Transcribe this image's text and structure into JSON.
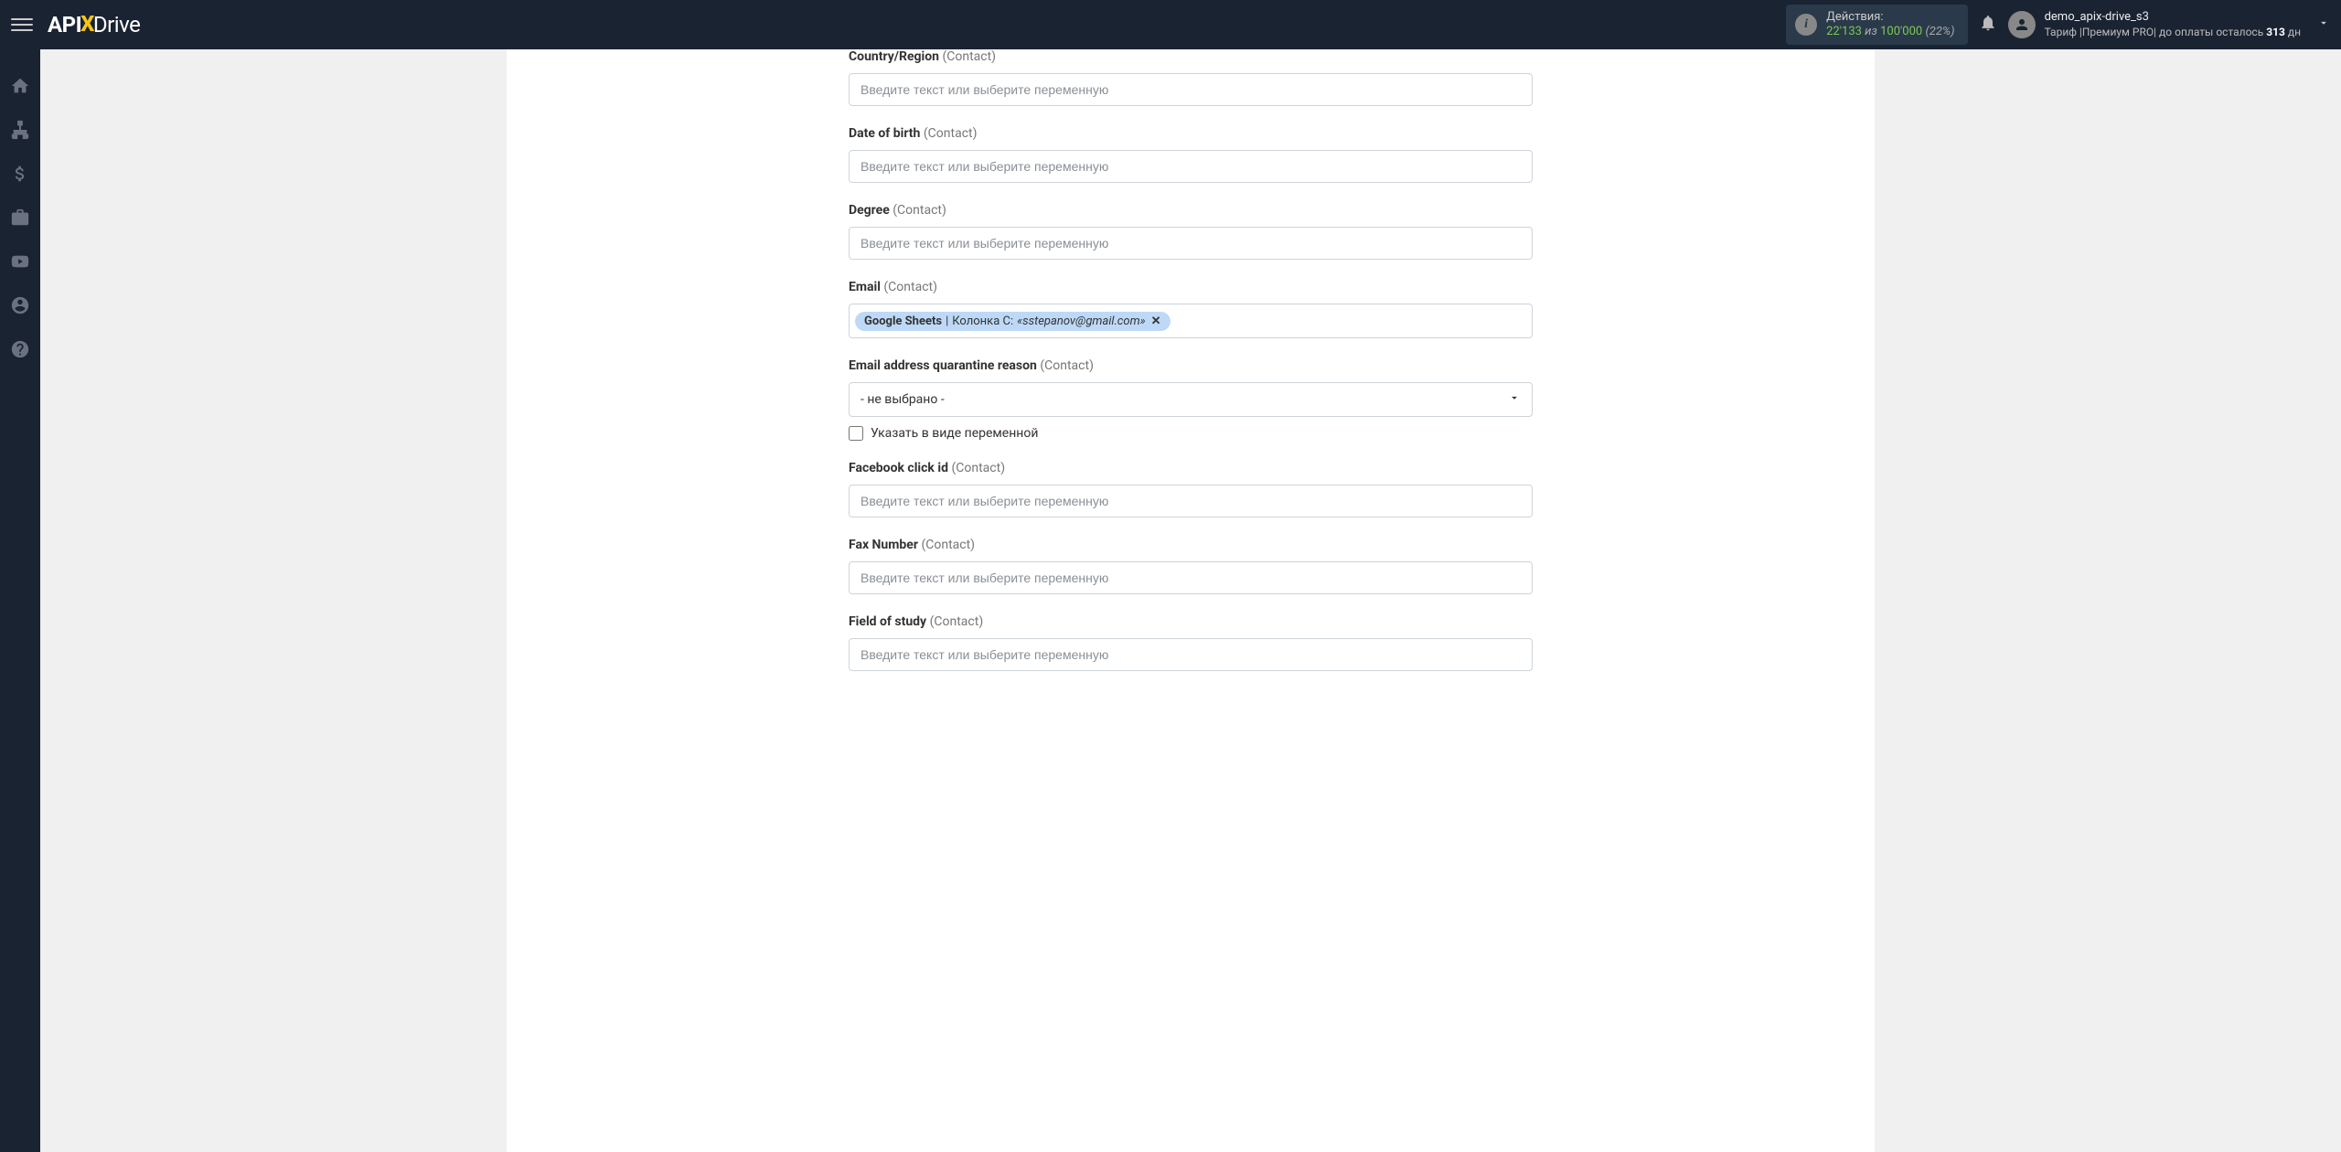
{
  "header": {
    "logo_api": "API",
    "logo_x": "X",
    "logo_drive": "Drive",
    "actions_label": "Действия:",
    "actions_count": "22'133",
    "actions_of": "из",
    "actions_total": "100'000",
    "actions_pct": "(22%)",
    "user_name": "demo_apix-drive_s3",
    "plan_prefix": "Тариф |",
    "plan_name": "Премиум PRO",
    "plan_mid": "| до оплаты осталось ",
    "plan_days": "313",
    "plan_suffix": " дн"
  },
  "form": {
    "placeholder": "Введите текст или выберите переменную",
    "select_placeholder": "- не выбрано -",
    "checkbox_label": "Указать в виде переменной",
    "fields": {
      "country": {
        "label": "Country/Region",
        "suffix": "(Contact)"
      },
      "dob": {
        "label": "Date of birth",
        "suffix": "(Contact)"
      },
      "degree": {
        "label": "Degree",
        "suffix": "(Contact)"
      },
      "email": {
        "label": "Email",
        "suffix": "(Contact)"
      },
      "quarantine": {
        "label": "Email address quarantine reason",
        "suffix": "(Contact)"
      },
      "fbclid": {
        "label": "Facebook click id",
        "suffix": "(Contact)"
      },
      "fax": {
        "label": "Fax Number",
        "suffix": "(Contact)"
      },
      "study": {
        "label": "Field of study",
        "suffix": "(Contact)"
      }
    },
    "email_token": {
      "src": "Google Sheets",
      "sep": " | ",
      "col": "Колонка C: ",
      "val": "«sstepanov@gmail.com»",
      "remove": "✕"
    }
  }
}
